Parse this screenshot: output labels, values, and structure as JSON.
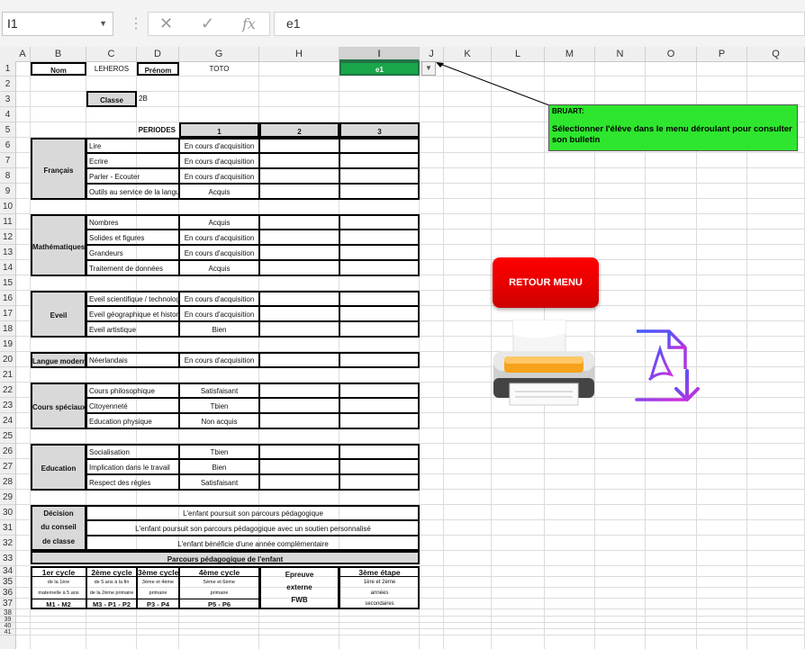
{
  "formula_bar": {
    "name_box": "I1",
    "formula": "e1",
    "fx": "fx"
  },
  "columns": [
    "A",
    "B",
    "C",
    "D",
    "G",
    "H",
    "I",
    "J",
    "K",
    "L",
    "M",
    "N",
    "O",
    "P",
    "Q"
  ],
  "rows": [
    "1",
    "2",
    "3",
    "4",
    "5",
    "6",
    "7",
    "8",
    "9",
    "10",
    "11",
    "12",
    "13",
    "14",
    "15",
    "16",
    "17",
    "18",
    "19",
    "20",
    "21",
    "22",
    "23",
    "24",
    "25",
    "26",
    "27",
    "28",
    "29",
    "30",
    "31",
    "32",
    "33",
    "34",
    "35",
    "36",
    "37",
    "38",
    "39",
    "40",
    "41"
  ],
  "bulletin": {
    "nom_label": "Nom",
    "nom_value": "LEHEROS",
    "prenom_label": "Prénom",
    "prenom_value": "TOTO",
    "classe_label": "Classe",
    "classe_value": "2B",
    "selected_student": "e1",
    "periodes_label": "PERIODES",
    "periods": [
      "1",
      "2",
      "3"
    ]
  },
  "sections": [
    {
      "name": "Français",
      "items": [
        {
          "label": "Lire",
          "p1": "En cours d'acquisition"
        },
        {
          "label": "Ecrire",
          "p1": "En cours d'acquisition"
        },
        {
          "label": "Parler - Ecouter",
          "p1": "En cours d'acquisition"
        },
        {
          "label": "Outils au service de la langue",
          "p1": "Acquis"
        }
      ]
    },
    {
      "name": "Mathématiques",
      "items": [
        {
          "label": "Nombres",
          "p1": "Acquis"
        },
        {
          "label": "Solides et figures",
          "p1": "En cours d'acquisition"
        },
        {
          "label": "Grandeurs",
          "p1": "En cours d'acquisition"
        },
        {
          "label": "Traitement de données",
          "p1": "Acquis"
        }
      ]
    },
    {
      "name": "Eveil",
      "items": [
        {
          "label": "Eveil scientifique / technologique",
          "p1": "En cours d'acquisition"
        },
        {
          "label": "Eveil géographique et historique",
          "p1": "En cours d'acquisition"
        },
        {
          "label": "Eveil artistique",
          "p1": "Bien"
        }
      ]
    },
    {
      "name": "Langue moderne",
      "items": [
        {
          "label": "Néerlandais",
          "p1": "En cours d'acquisition"
        }
      ]
    },
    {
      "name": "Cours spéciaux",
      "items": [
        {
          "label": "Cours philosophique",
          "p1": "Satisfaisant"
        },
        {
          "label": "Citoyenneté",
          "p1": "Tbien"
        },
        {
          "label": "Education physique",
          "p1": "Non acquis"
        }
      ]
    },
    {
      "name": "Education",
      "items": [
        {
          "label": "Socialisation",
          "p1": "Tbien"
        },
        {
          "label": "Implication dans le travail",
          "p1": "Bien"
        },
        {
          "label": "Respect des règles",
          "p1": "Satisfaisant"
        }
      ]
    }
  ],
  "decision": {
    "label_lines": [
      "Décision",
      "du conseil",
      "de classe"
    ],
    "options": [
      "L'enfant poursuit son parcours pédagogique",
      "L'enfant poursuit son parcours pédagogique avec un soutien personnalisé",
      "L'enfant bénéficie d'une année complémentaire"
    ]
  },
  "parcours": {
    "title": "Parcours pédagogique de l'enfant",
    "cycles": [
      {
        "title": "1er cycle",
        "l1": "de la 1ère",
        "l2": "maternelle à 5 ans",
        "code": "M1 - M2"
      },
      {
        "title": "2ème cycle",
        "l1": "de 5 ans à la fin",
        "l2": "de la 2ème primaire",
        "code": "M3 - P1 - P2"
      },
      {
        "title": "3ème cycle",
        "l1": "3ème et 4ème",
        "l2": "primaire",
        "code": "P3 - P4"
      },
      {
        "title": "4ème cycle",
        "l1": "5ème et 6ème",
        "l2": "primaire",
        "code": "P5 - P6"
      }
    ],
    "epreuve": [
      "Epreuve",
      "externe",
      "FWB"
    ],
    "etape": {
      "title": "3ème étape",
      "l1": "1ère et 2ème",
      "l2": "années",
      "l3": "secondaires"
    }
  },
  "comment": {
    "author": "BRUART:",
    "text": "Sélectionner l'élève dans le menu déroulant pour consulter son bulletin",
    "color": "#2ee62e"
  },
  "buttons": {
    "retour_menu": "RETOUR MENU"
  },
  "icons": {
    "print": "printer-icon",
    "pdf": "pdf-download-icon"
  }
}
